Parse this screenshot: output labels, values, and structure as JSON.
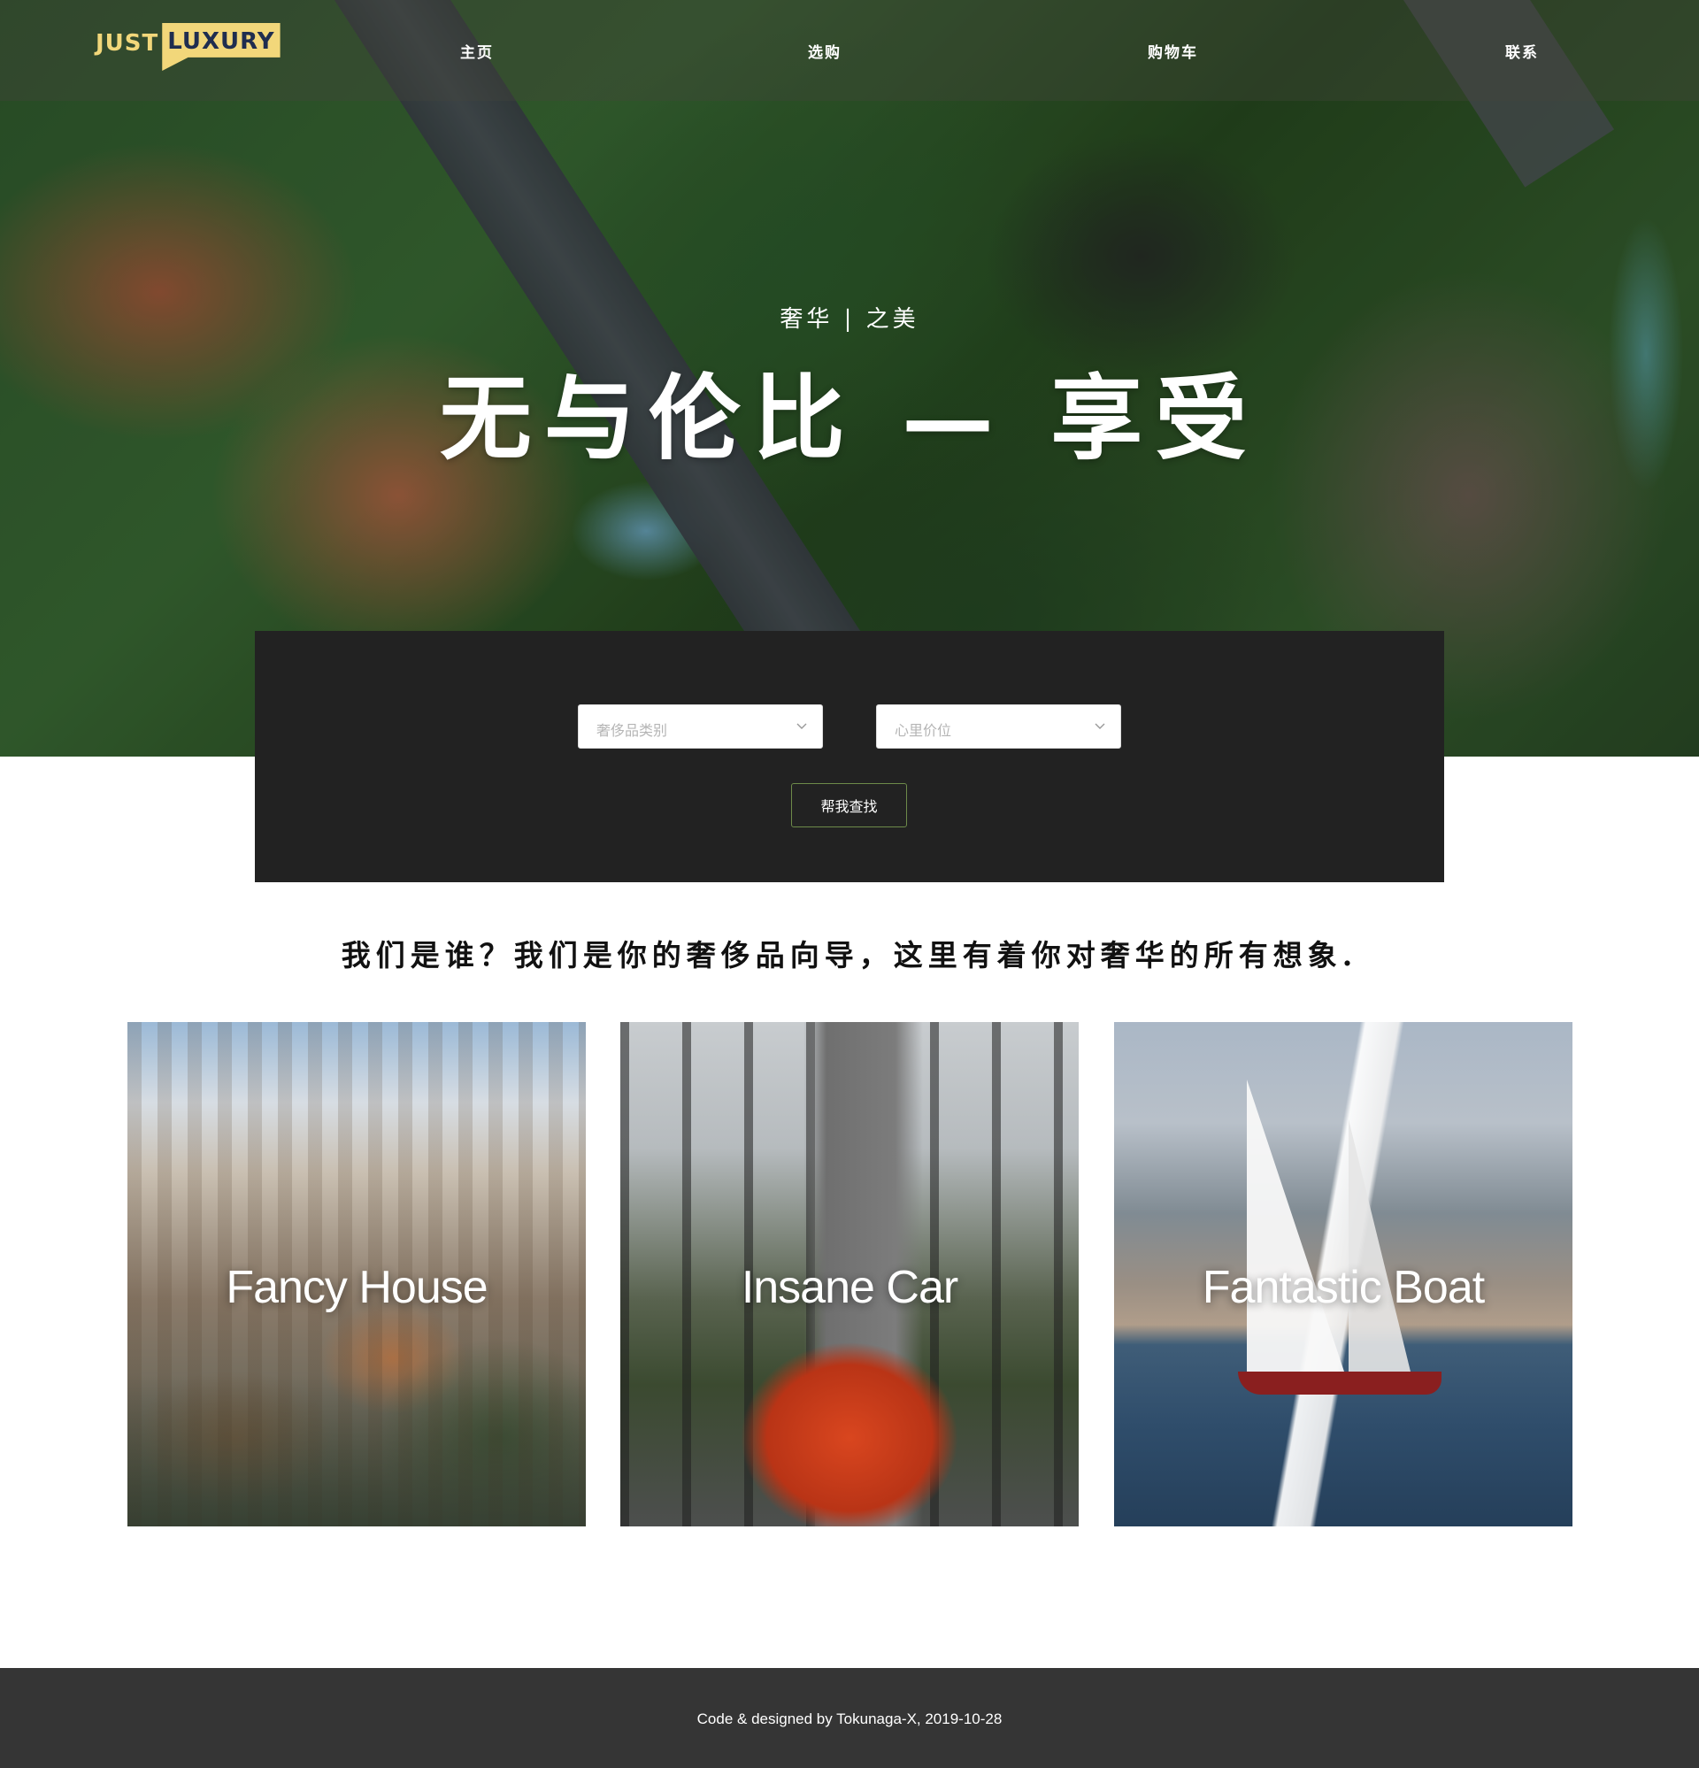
{
  "brand": {
    "logo_part1": "JUST",
    "logo_part2": "LUXURY"
  },
  "nav": {
    "items": [
      {
        "label": "主页"
      },
      {
        "label": "选购"
      },
      {
        "label": "购物车"
      },
      {
        "label": "联系"
      }
    ]
  },
  "hero": {
    "subtitle": "奢华 | 之美",
    "headline": "无与伦比 — 享受"
  },
  "search": {
    "category_placeholder": "奢侈品类别",
    "price_placeholder": "心里价位",
    "button_label": "帮我查找"
  },
  "intro": {
    "text": "我们是谁？我们是你的奢侈品向导，这里有着你对奢华的所有想象."
  },
  "cards": [
    {
      "title": "Fancy House"
    },
    {
      "title": "Insane Car"
    },
    {
      "title": "Fantastic Boat"
    }
  ],
  "footer": {
    "text": "Code & designed by Tokunaga-X, 2019-10-28"
  },
  "colors": {
    "logo_yellow": "#f2d77a",
    "logo_navy": "#1f2d4f",
    "panel_dark": "#222222",
    "button_border": "#6d8a4a",
    "footer_bg": "#353535"
  },
  "icons": [
    "chevron-down-icon"
  ]
}
